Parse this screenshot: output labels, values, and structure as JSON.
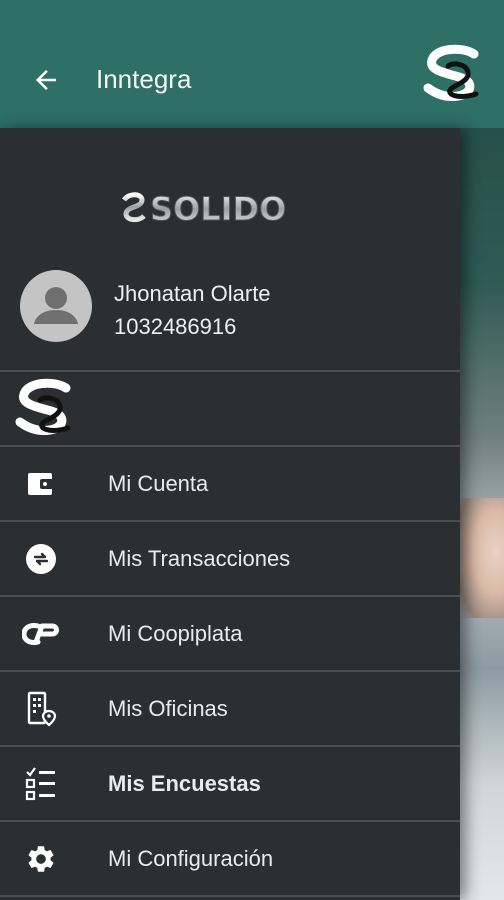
{
  "appbar": {
    "title": "Inntegra",
    "back_icon": "arrow-left-icon",
    "logo": "solido-s-logo",
    "color": "#2e6f66"
  },
  "drawer": {
    "brand": "SOLIDO",
    "profile": {
      "name": "Jhonatan Olarte",
      "id": "1032486916"
    },
    "menu": [
      {
        "label": "Mi Cuenta",
        "icon": "wallet-icon"
      },
      {
        "label": "Mis Transacciones",
        "icon": "exchange-icon"
      },
      {
        "label": "Mi Coopiplata",
        "icon": "coopiplata-icon"
      },
      {
        "label": "Mis Oficinas",
        "icon": "office-location-icon"
      },
      {
        "label": "Mis Encuestas",
        "icon": "checklist-icon"
      },
      {
        "label": "Mi Configuración",
        "icon": "gear-icon"
      }
    ]
  }
}
